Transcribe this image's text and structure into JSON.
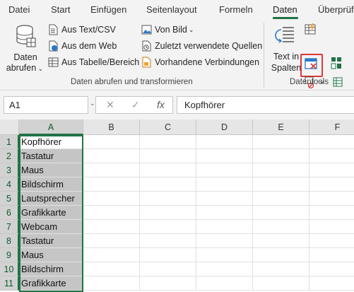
{
  "tabs": [
    "Datei",
    "Start",
    "Einfügen",
    "Seitenlayout",
    "Formeln",
    "Daten",
    "Überprüfen"
  ],
  "active_tab": "Daten",
  "ribbon": {
    "group1": {
      "big_button_line1": "Daten",
      "big_button_line2": "abrufen",
      "items": [
        "Aus Text/CSV",
        "Aus dem Web",
        "Aus Tabelle/Bereich"
      ],
      "items2": [
        "Von Bild",
        "Zuletzt verwendete Quellen",
        "Vorhandene Verbindungen"
      ],
      "label": "Daten abrufen und transformieren"
    },
    "group2": {
      "big_button_line1": "Text in",
      "big_button_line2": "Spalten",
      "label": "Datentools"
    }
  },
  "formula_bar": {
    "name_box": "A1",
    "cancel": "✕",
    "confirm": "✓",
    "fx": "fx",
    "content": "Kopfhörer"
  },
  "columns": [
    "A",
    "B",
    "C",
    "D",
    "E",
    "F"
  ],
  "rows": [
    {
      "num": "1",
      "a": "Kopfhörer"
    },
    {
      "num": "2",
      "a": "Tastatur"
    },
    {
      "num": "3",
      "a": "Maus"
    },
    {
      "num": "4",
      "a": "Bildschirm"
    },
    {
      "num": "5",
      "a": "Lautsprecher"
    },
    {
      "num": "6",
      "a": "Grafikkarte"
    },
    {
      "num": "7",
      "a": "Webcam"
    },
    {
      "num": "8",
      "a": "Tastatur"
    },
    {
      "num": "9",
      "a": "Maus"
    },
    {
      "num": "10",
      "a": "Bildschirm"
    },
    {
      "num": "11",
      "a": "Grafikkarte"
    }
  ],
  "colors": {
    "accent": "#217346",
    "highlight": "#e03838"
  }
}
